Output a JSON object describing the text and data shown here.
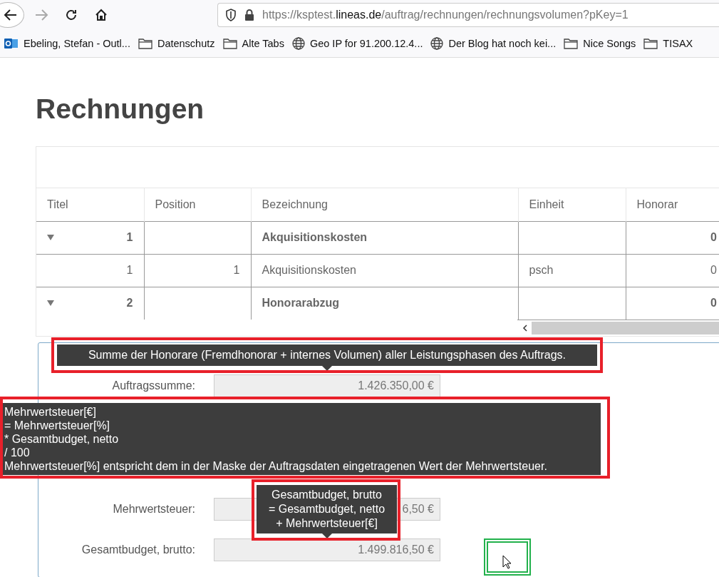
{
  "browser": {
    "url": {
      "prefix": "https://ksptest.",
      "domain": "lineas.de",
      "path": "/auftrag/rechnungen/rechnungsvolumen?pKey=1"
    }
  },
  "bookmarks": [
    {
      "kind": "mail",
      "label": "Ebeling, Stefan - Outl..."
    },
    {
      "kind": "folder",
      "label": "Datenschutz"
    },
    {
      "kind": "folder",
      "label": "Alte Tabs"
    },
    {
      "kind": "globe",
      "label": "Geo IP for 91.200.12.4..."
    },
    {
      "kind": "globe",
      "label": "Der Blog hat noch kei..."
    },
    {
      "kind": "folder",
      "label": "Nice Songs"
    },
    {
      "kind": "folder",
      "label": "TISAX"
    }
  ],
  "page": {
    "title": "Rechnungen"
  },
  "table": {
    "columns": [
      "Titel",
      "Position",
      "Bezeichnung",
      "Einheit",
      "Honorar"
    ],
    "rows": [
      {
        "kind": "group",
        "expanded": true,
        "cells": [
          "1",
          "",
          "Akquisitionskosten",
          "",
          "0"
        ]
      },
      {
        "kind": "item",
        "cells": [
          "1",
          "1",
          "Akquisitionskosten",
          "psch",
          "0"
        ]
      },
      {
        "kind": "group",
        "expanded": true,
        "cells": [
          "2",
          "",
          "Honorarabzug",
          "",
          "0"
        ]
      }
    ]
  },
  "summen": {
    "fields": [
      {
        "label": "Auftragssumme:",
        "inputs": [
          {
            "value": "1.426.350,00 €",
            "readonly": true
          }
        ]
      },
      {
        "label": "Mehrwertsteuer:",
        "inputs": [
          {
            "readonly": true
          },
          {
            "value": "6,50 €",
            "readonly": true
          }
        ]
      },
      {
        "label": "Gesamtbudget, brutto:",
        "inputs": [
          {
            "value": "1.499.816,50 €",
            "readonly": true
          }
        ]
      }
    ]
  },
  "tooltips": [
    {
      "kind": "centered",
      "lines": [
        "Summe der Honorare (Fremdhonorar + internes Volumen) aller Leistungsphasen des Auftrags."
      ]
    },
    {
      "kind": "left",
      "lines": [
        "Mehrwertsteuer[€]",
        "= Mehrwertsteuer[%]",
        "* Gesamtbudget, netto",
        "/ 100",
        "Mehrwertsteuer[%] entspricht dem in der Maske der Auftragsdaten eingetragenen Wert der Mehrwertsteuer."
      ]
    },
    {
      "kind": "centered",
      "lines": [
        "Gesamtbudget, brutto",
        "= Gesamtbudget, netto",
        "+ Mehrwertsteuer[€]"
      ]
    }
  ],
  "annotations": [
    {
      "color": "#e8202a"
    },
    {
      "color": "#e8202a"
    },
    {
      "color": "#e8202a"
    },
    {
      "color": "#22b14c"
    }
  ]
}
